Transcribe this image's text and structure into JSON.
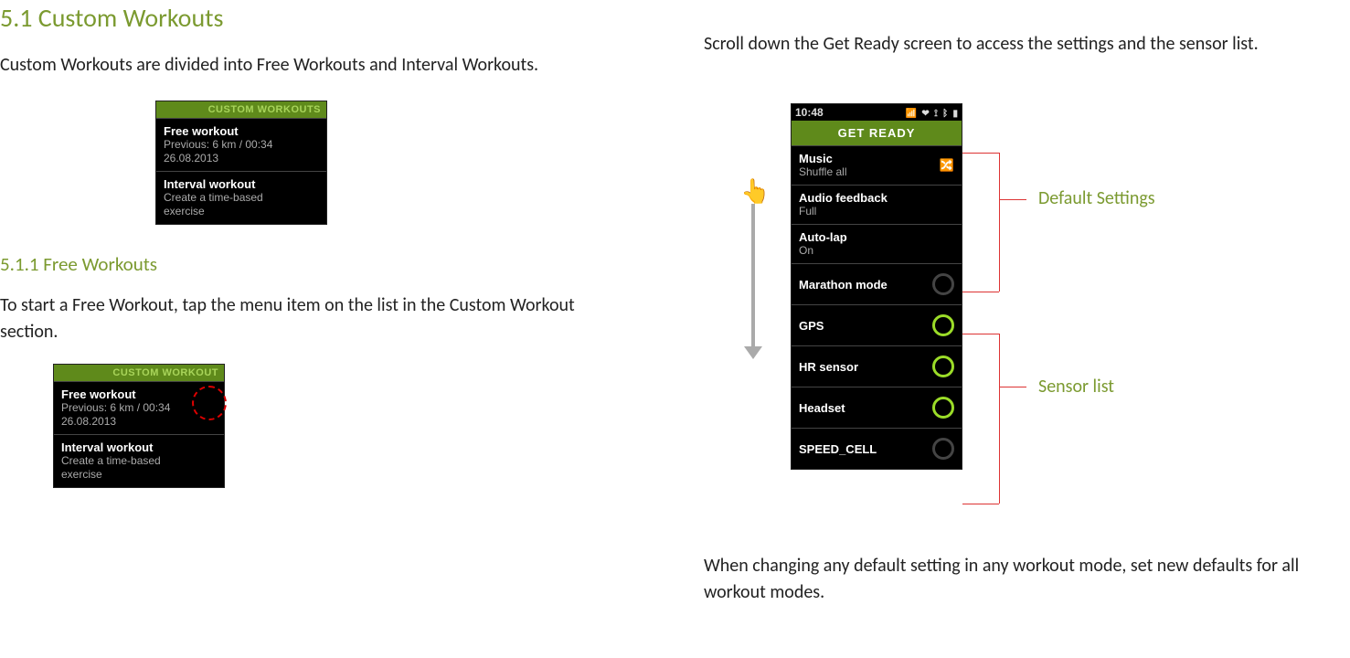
{
  "left": {
    "h1": "5.1 Custom Workouts",
    "p1": "Custom Workouts are divided into Free Workouts and Interval Workouts.",
    "h2": "5.1.1 Free Workouts",
    "p2": "To start a Free Workout, tap the menu item on the list in the Custom Workout section."
  },
  "right": {
    "p1": "Scroll down the Get Ready screen to access the settings and the sensor list.",
    "p2": "When changing any default setting in any workout mode, set new defaults for all workout modes.",
    "label_default": "Default Settings",
    "label_sensor": "Sensor list"
  },
  "phone1": {
    "title": "CUSTOM WORKOUTS",
    "free_t": "Free workout",
    "free_s1": "Previous: 6 km / 00:34",
    "free_s2": "26.08.2013",
    "int_t": "Interval workout",
    "int_s1": "Create a time-based",
    "int_s2": "exercise"
  },
  "phone1b_title": "CUSTOM WORKOUT",
  "ready": {
    "time": "10:48",
    "title": "GET READY",
    "music_t": "Music",
    "music_s": "Shuffle all",
    "af_t": "Audio feedback",
    "af_s": "Full",
    "al_t": "Auto-lap",
    "al_s": "On",
    "mm_t": "Marathon mode",
    "gps": "GPS",
    "hr": "HR sensor",
    "hs": "Headset",
    "sc": "SPEED_CELL"
  }
}
